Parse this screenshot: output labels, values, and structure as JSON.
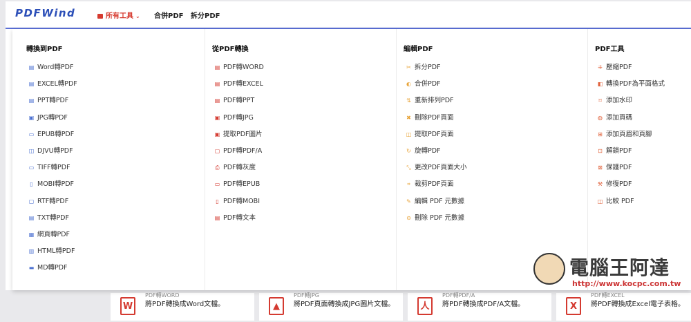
{
  "header": {
    "logo": "PDFWind",
    "nav_all": "所有工具",
    "nav_merge": "合併PDF",
    "nav_split": "拆分PDF"
  },
  "columns": [
    {
      "title": "轉換到PDF",
      "items": [
        {
          "label": "Word轉PDF",
          "icon": "doc-icon",
          "color": "#4a6fd0"
        },
        {
          "label": "EXCEL轉PDF",
          "icon": "doc-icon",
          "color": "#4a6fd0"
        },
        {
          "label": "PPT轉PDF",
          "icon": "doc-icon",
          "color": "#4a6fd0"
        },
        {
          "label": "JPG轉PDF",
          "icon": "image-icon",
          "color": "#4a6fd0"
        },
        {
          "label": "EPUB轉PDF",
          "icon": "book-icon",
          "color": "#4a6fd0"
        },
        {
          "label": "DJVU轉PDF",
          "icon": "picture-icon",
          "color": "#4a6fd0"
        },
        {
          "label": "TIFF轉PDF",
          "icon": "frame-icon",
          "color": "#4a6fd0"
        },
        {
          "label": "MOBI轉PDF",
          "icon": "tablet-icon",
          "color": "#4a6fd0"
        },
        {
          "label": "RTF轉PDF",
          "icon": "file-icon",
          "color": "#4a6fd0"
        },
        {
          "label": "TXT轉PDF",
          "icon": "text-icon",
          "color": "#4a6fd0"
        },
        {
          "label": "網頁轉PDF",
          "icon": "web-icon",
          "color": "#4a6fd0"
        },
        {
          "label": "HTML轉PDF",
          "icon": "html-icon",
          "color": "#4a6fd0"
        },
        {
          "label": "MD轉PDF",
          "icon": "markdown-icon",
          "color": "#4a6fd0"
        }
      ]
    },
    {
      "title": "從PDF轉換",
      "items": [
        {
          "label": "PDF轉WORD",
          "icon": "doc-icon",
          "color": "#d43a30"
        },
        {
          "label": "PDF轉EXCEL",
          "icon": "doc-icon",
          "color": "#d43a30"
        },
        {
          "label": "PDF轉PPT",
          "icon": "doc-icon",
          "color": "#d43a30"
        },
        {
          "label": "PDF轉JPG",
          "icon": "image-icon",
          "color": "#d43a30"
        },
        {
          "label": "提取PDF圖片",
          "icon": "image-icon",
          "color": "#d43a30"
        },
        {
          "label": "PDF轉PDF/A",
          "icon": "file-icon",
          "color": "#d43a30"
        },
        {
          "label": "PDF轉灰度",
          "icon": "print-icon",
          "color": "#d43a30"
        },
        {
          "label": "PDF轉EPUB",
          "icon": "book-icon",
          "color": "#d43a30"
        },
        {
          "label": "PDF轉MOBI",
          "icon": "tablet-icon",
          "color": "#d43a30"
        },
        {
          "label": "PDF轉文本",
          "icon": "text-icon",
          "color": "#d43a30"
        }
      ]
    },
    {
      "title": "編輯PDF",
      "items": [
        {
          "label": "拆分PDF",
          "icon": "scissors-icon",
          "color": "#e8a43a"
        },
        {
          "label": "合併PDF",
          "icon": "merge-icon",
          "color": "#e8a43a"
        },
        {
          "label": "重新排列PDF",
          "icon": "sort-icon",
          "color": "#e8a43a"
        },
        {
          "label": "刪除PDF頁面",
          "icon": "close-icon",
          "color": "#e8a43a"
        },
        {
          "label": "提取PDF頁面",
          "icon": "extract-icon",
          "color": "#e8a43a"
        },
        {
          "label": "旋轉PDF",
          "icon": "rotate-icon",
          "color": "#e8a43a"
        },
        {
          "label": "更改PDF頁面大小",
          "icon": "resize-icon",
          "color": "#e8a43a"
        },
        {
          "label": "裁剪PDF頁面",
          "icon": "crop-icon",
          "color": "#e8a43a"
        },
        {
          "label": "編輯 PDF 元數據",
          "icon": "edit-icon",
          "color": "#e8a43a"
        },
        {
          "label": "刪除 PDF 元數據",
          "icon": "delete-meta-icon",
          "color": "#e8a43a"
        }
      ]
    },
    {
      "title": "PDF工具",
      "items": [
        {
          "label": "壓縮PDF",
          "icon": "compress-icon",
          "color": "#e0603a"
        },
        {
          "label": "轉換PDF為平面格式",
          "icon": "flatten-icon",
          "color": "#e0603a"
        },
        {
          "label": "添加水印",
          "icon": "bookmark-icon",
          "color": "#e0603a"
        },
        {
          "label": "添加頁碼",
          "icon": "number-icon",
          "color": "#e0603a"
        },
        {
          "label": "添加頁眉和頁腳",
          "icon": "plus-box-icon",
          "color": "#e0603a"
        },
        {
          "label": "解鎖PDF",
          "icon": "unlock-icon",
          "color": "#e0603a"
        },
        {
          "label": "保護PDF",
          "icon": "lock-icon",
          "color": "#e0603a"
        },
        {
          "label": "修復PDF",
          "icon": "wrench-icon",
          "color": "#e0603a"
        },
        {
          "label": "比較 PDF",
          "icon": "compare-icon",
          "color": "#e0603a"
        }
      ]
    }
  ],
  "cards": [
    {
      "title": "PDF轉WORD",
      "desc": "將PDF轉換成Word文檔。",
      "icon_text": "W",
      "icon": "word-file-icon"
    },
    {
      "title": "PDF轉JPG",
      "desc": "將PDF頁面轉換成JPG圖片文檔。",
      "icon_text": "▲",
      "icon": "image-file-icon"
    },
    {
      "title": "PDF轉PDF/A",
      "desc": "將PDF轉換成PDF/A文檔。",
      "icon_text": "人",
      "icon": "pdf-file-icon"
    },
    {
      "title": "PDF轉EXCEL",
      "desc": "將PDF轉換成Excel電子表格。",
      "icon_text": "X",
      "icon": "excel-file-icon"
    }
  ],
  "watermark": {
    "text": "電腦王阿達",
    "url": "http://www.kocpc.com.tw"
  }
}
